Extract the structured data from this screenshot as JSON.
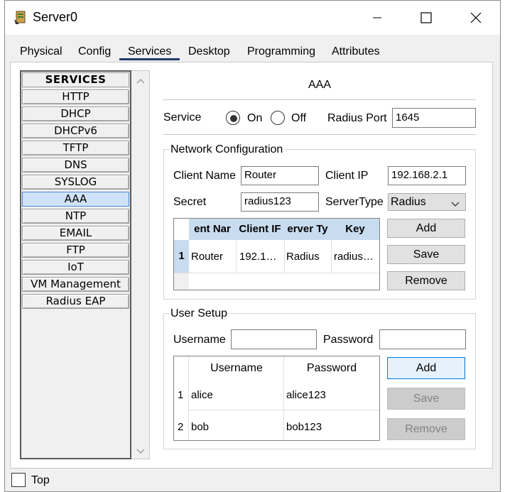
{
  "window": {
    "title": "Server0"
  },
  "tabs": [
    "Physical",
    "Config",
    "Services",
    "Desktop",
    "Programming",
    "Attributes"
  ],
  "active_tab": "Services",
  "services": {
    "header": "SERVICES",
    "items": [
      "HTTP",
      "DHCP",
      "DHCPv6",
      "TFTP",
      "DNS",
      "SYSLOG",
      "AAA",
      "NTP",
      "EMAIL",
      "FTP",
      "IoT",
      "VM Management",
      "Radius EAP"
    ],
    "selected": "AAA"
  },
  "aaa": {
    "title": "AAA",
    "service_label": "Service",
    "on_label": "On",
    "off_label": "Off",
    "service_state": "On",
    "radius_port_label": "Radius Port",
    "radius_port": "1645"
  },
  "network": {
    "group_label": "Network Configuration",
    "client_name_label": "Client Name",
    "client_name": "Router",
    "client_ip_label": "Client IP",
    "client_ip": "192.168.2.1",
    "secret_label": "Secret",
    "secret": "radius123",
    "server_type_label": "ServerType",
    "server_type": "Radius",
    "columns": [
      "ent Nar",
      "Client IF",
      "erver Ty",
      "Key"
    ],
    "rows": [
      {
        "index": "1",
        "name": "Router",
        "ip": "192.1…",
        "type": "Radius",
        "key": "radius…"
      }
    ],
    "add_label": "Add",
    "save_label": "Save",
    "remove_label": "Remove"
  },
  "users": {
    "group_label": "User Setup",
    "username_label": "Username",
    "password_label": "Password",
    "username_value": "",
    "password_value": "",
    "columns": [
      "Username",
      "Password"
    ],
    "rows": [
      {
        "index": "1",
        "username": "alice",
        "password": "alice123"
      },
      {
        "index": "2",
        "username": "bob",
        "password": "bob123"
      }
    ],
    "add_label": "Add",
    "save_label": "Save",
    "remove_label": "Remove"
  },
  "footer": {
    "top_label": "Top"
  },
  "icons": {
    "app": "server-app-icon",
    "minimize": "minimize-icon",
    "maximize": "maximize-icon",
    "close": "close-icon"
  }
}
